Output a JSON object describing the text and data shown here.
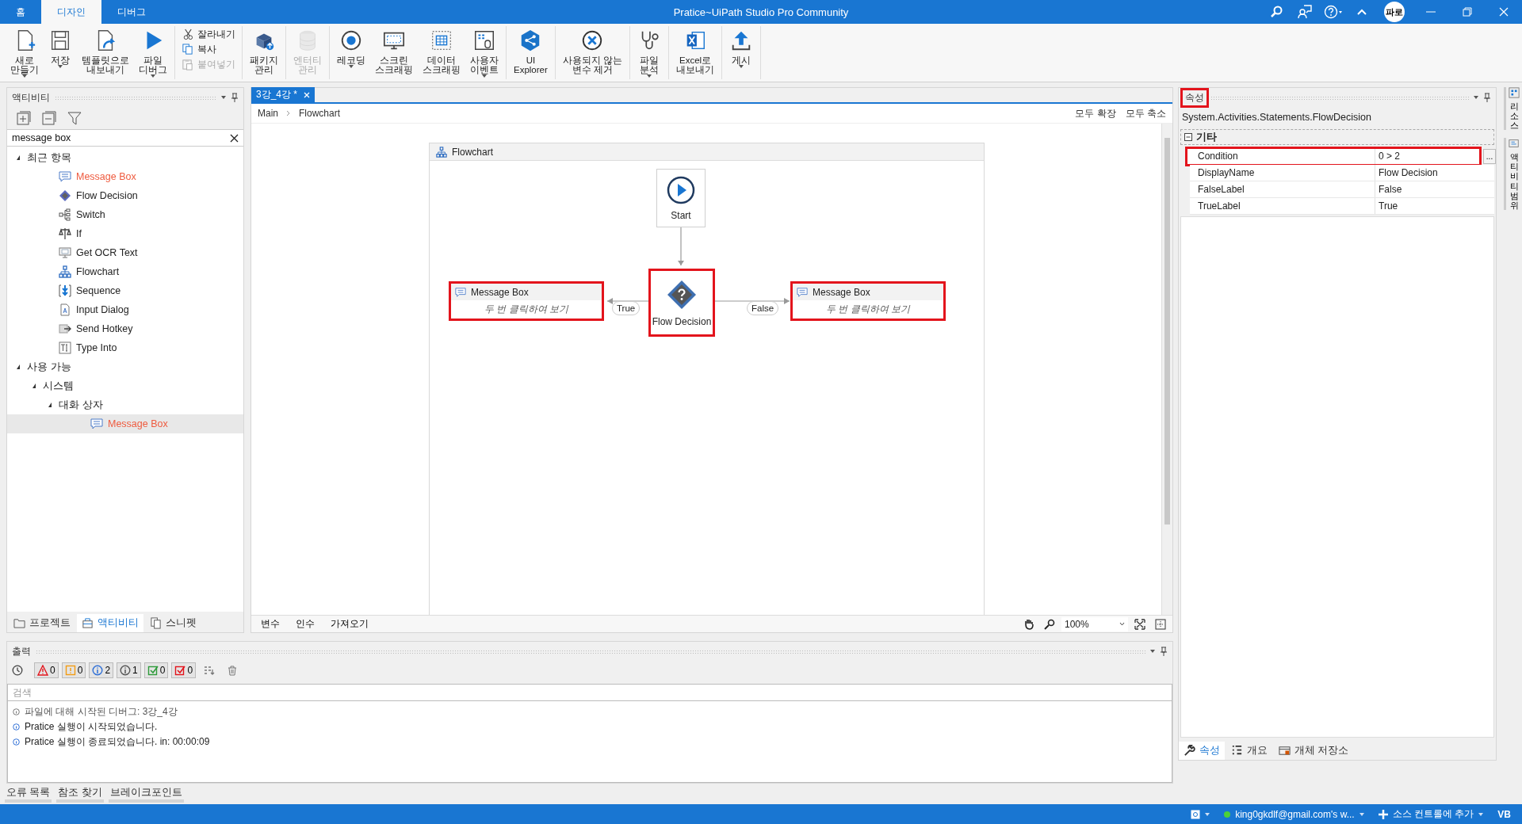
{
  "title_bar": {
    "home_tab": "홈",
    "tabs": [
      {
        "label": "디자인",
        "selected": true
      },
      {
        "label": "디버그",
        "selected": false
      }
    ],
    "title": "Pratice~UiPath Studio Pro Community",
    "avatar": "파로"
  },
  "ribbon": {
    "groups": [
      [
        {
          "kind": "new",
          "lines": [
            "새로",
            "만들기"
          ],
          "dropdown": true,
          "disabled": false
        },
        {
          "kind": "save",
          "lines": [
            "저장"
          ],
          "dropdown": true,
          "disabled": false
        },
        {
          "kind": "export",
          "lines": [
            "템플릿으로",
            "내보내기"
          ],
          "dropdown": false,
          "disabled": false
        },
        {
          "kind": "debug",
          "lines": [
            "파일",
            "디버그"
          ],
          "dropdown": true,
          "disabled": false
        }
      ],
      [
        {
          "kind": "cut",
          "lines": [
            "잘라내기"
          ],
          "disabled": false
        },
        {
          "kind": "copy",
          "lines": [
            "복사"
          ],
          "disabled": false
        },
        {
          "kind": "paste",
          "lines": [
            "붙여넣기"
          ],
          "disabled": true
        }
      ],
      [
        {
          "kind": "package",
          "lines": [
            "패키지",
            "관리"
          ],
          "dropdown": false,
          "disabled": false
        }
      ],
      [
        {
          "kind": "entity",
          "lines": [
            "엔터티",
            "관리"
          ],
          "dropdown": false,
          "disabled": true
        }
      ],
      [
        {
          "kind": "record",
          "lines": [
            "레코딩"
          ],
          "dropdown": true,
          "disabled": false
        },
        {
          "kind": "screen",
          "lines": [
            "스크린",
            "스크래핑"
          ],
          "dropdown": false,
          "disabled": false
        },
        {
          "kind": "data",
          "lines": [
            "데이터",
            "스크래핑"
          ],
          "dropdown": false,
          "disabled": false
        },
        {
          "kind": "event",
          "lines": [
            "사용자",
            "이벤트"
          ],
          "dropdown": true,
          "disabled": false
        }
      ],
      [
        {
          "kind": "uiexplorer",
          "lines": [
            "UI",
            "Explorer"
          ],
          "dropdown": false,
          "disabled": false
        }
      ],
      [
        {
          "kind": "remove",
          "lines": [
            "사용되지 않는",
            "변수 제거"
          ],
          "dropdown": false,
          "disabled": false
        }
      ],
      [
        {
          "kind": "analyze",
          "lines": [
            "파일",
            "분석"
          ],
          "dropdown": true,
          "disabled": false
        }
      ],
      [
        {
          "kind": "excel",
          "lines": [
            "Excel로",
            "내보내기"
          ],
          "dropdown": false,
          "disabled": false
        }
      ],
      [
        {
          "kind": "publish",
          "lines": [
            "게시"
          ],
          "dropdown": true,
          "disabled": false
        }
      ]
    ]
  },
  "activity_panel": {
    "title": "액티비티",
    "search": "message box",
    "tree": [
      {
        "label": "최근 항목",
        "expanded": true,
        "matched": false,
        "selected": false,
        "children": [
          {
            "label": "Message Box",
            "kind": "message",
            "matched": true,
            "selected": false
          },
          {
            "label": "Flow Decision",
            "kind": "decision",
            "matched": false,
            "selected": false
          },
          {
            "label": "Switch",
            "kind": "switch",
            "matched": false,
            "selected": false
          },
          {
            "label": "If",
            "kind": "if",
            "matched": false,
            "selected": false
          },
          {
            "label": "Get OCR Text",
            "kind": "ocr",
            "matched": false,
            "selected": false
          },
          {
            "label": "Flowchart",
            "kind": "flowchart",
            "matched": false,
            "selected": false
          },
          {
            "label": "Sequence",
            "kind": "sequence",
            "matched": false,
            "selected": false
          },
          {
            "label": "Input Dialog",
            "kind": "input",
            "matched": false,
            "selected": false
          },
          {
            "label": "Send Hotkey",
            "kind": "hotkey",
            "matched": false,
            "selected": false
          },
          {
            "label": "Type Into",
            "kind": "type",
            "matched": false,
            "selected": false
          }
        ]
      },
      {
        "label": "사용 가능",
        "expanded": true,
        "matched": false,
        "selected": false,
        "children": [
          {
            "label": "시스템",
            "expanded": true,
            "matched": false,
            "selected": false,
            "children": [
              {
                "label": "대화 상자",
                "expanded": true,
                "matched": false,
                "selected": false,
                "children": [
                  {
                    "label": "Message Box",
                    "kind": "message",
                    "matched": true,
                    "selected": true
                  }
                ]
              }
            ]
          }
        ]
      }
    ],
    "tabs": [
      {
        "label": "프로젝트",
        "kind": "project",
        "selected": false
      },
      {
        "label": "액티비티",
        "kind": "activity",
        "selected": true
      },
      {
        "label": "스니펫",
        "kind": "snippet",
        "selected": false
      }
    ]
  },
  "designer": {
    "tabs": [
      {
        "label": "3강_4강 *",
        "selected": true
      }
    ],
    "breadcrumb": [
      "Main",
      "Flowchart"
    ],
    "expand_all": "모두 확장",
    "collapse_all": "모두 축소",
    "flowchart": {
      "title": "Flowchart",
      "start": {
        "label": "Start"
      },
      "decision": {
        "label": "Flow Decision",
        "highlighted": true
      },
      "true_box": {
        "title": "Message Box",
        "hint": "두 번 클릭하여 보기",
        "highlighted": true
      },
      "false_box": {
        "title": "Message Box",
        "hint": "두 번 클릭하여 보기",
        "highlighted": true
      },
      "true_label": "True",
      "false_label": "False"
    },
    "bottom_tabs": [
      "변수",
      "인수",
      "가져오기"
    ],
    "zoom": "100%"
  },
  "output": {
    "title": "출력",
    "filters": [
      {
        "kind": "error",
        "count": "0"
      },
      {
        "kind": "warning",
        "count": "0"
      },
      {
        "kind": "info",
        "count": "2"
      },
      {
        "kind": "trace",
        "count": "1"
      },
      {
        "kind": "success",
        "count": "0"
      },
      {
        "kind": "fail",
        "count": "0"
      }
    ],
    "placeholder": "검색",
    "lines": [
      {
        "kind": "trace",
        "text": "파일에 대해 시작된 디버그: 3강_4강"
      },
      {
        "kind": "info",
        "text": "Pratice 실행이 시작되었습니다."
      },
      {
        "kind": "info",
        "text": "Pratice 실행이 종료되었습니다. in: 00:00:09"
      }
    ]
  },
  "bottom_tabs": [
    "오류 목록",
    "참조 찾기",
    "브레이크포인트"
  ],
  "properties": {
    "title": "속성",
    "title_highlighted": true,
    "type": "System.Activities.Statements.FlowDecision",
    "category": "기타",
    "rows": [
      {
        "name": "Condition",
        "value": "0 > 2",
        "button": "...",
        "highlighted": true
      },
      {
        "name": "DisplayName",
        "value": "Flow Decision",
        "highlighted": false
      },
      {
        "name": "FalseLabel",
        "value": "False",
        "highlighted": false
      },
      {
        "name": "TrueLabel",
        "value": "True",
        "highlighted": false
      }
    ],
    "tabs": [
      {
        "label": "속성",
        "kind": "properties",
        "selected": true
      },
      {
        "label": "개요",
        "kind": "outline",
        "selected": false
      },
      {
        "label": "개체 저장소",
        "kind": "repository",
        "selected": false
      }
    ]
  },
  "side_tabs": [
    {
      "label": "리소스",
      "kind": "resources"
    },
    {
      "label": "액티비티 범위",
      "kind": "coverage"
    }
  ],
  "status_bar": {
    "account": "king0gkdlf@gmail.com's w...",
    "source_control": "소스 컨트롤에 추가",
    "language": "VB"
  }
}
